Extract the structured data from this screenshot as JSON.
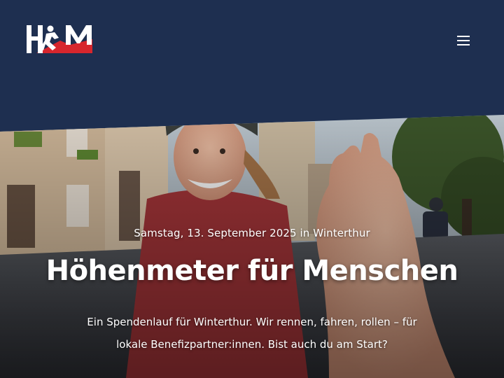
{
  "header": {
    "logo": {
      "text": "HFM",
      "icon": "runner-mountain-logo"
    },
    "menu": {
      "icon": "hamburger-menu-icon"
    }
  },
  "hero": {
    "date_line": "Samstag, 13. September 2025 in Winterthur",
    "title": "Höhenmeter für Menschen",
    "description": "Ein Spendenlauf für Winterthur. Wir rennen, fahren, rollen – für lokale Benefizpartner:innen. Bist auch du am Start?"
  },
  "colors": {
    "header_bg": "#1e2f50",
    "logo_accent": "#d7262d",
    "text": "#ffffff"
  }
}
